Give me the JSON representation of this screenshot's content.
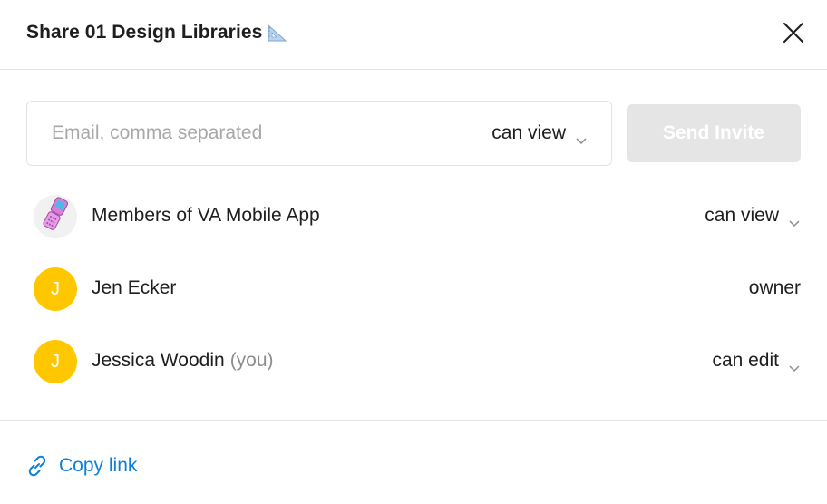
{
  "header": {
    "title": "Share 01 Design Libraries",
    "title_icon": "triangular-ruler-emoji",
    "close_icon": "close-icon"
  },
  "invite": {
    "placeholder": "Email, comma separated",
    "value": "",
    "permission": "can view",
    "send_label": "Send Invite",
    "send_enabled": false
  },
  "members": [
    {
      "name": "Members of VA Mobile App",
      "you_suffix": "",
      "avatar_type": "team",
      "avatar_icon": "flip-phone-icon",
      "role": "can view",
      "role_editable": true
    },
    {
      "name": "Jen Ecker",
      "you_suffix": "",
      "avatar_type": "user",
      "avatar_initial": "J",
      "role": "owner",
      "role_editable": false
    },
    {
      "name": "Jessica Woodin",
      "you_suffix": "(you)",
      "avatar_type": "user",
      "avatar_initial": "J",
      "role": "can edit",
      "role_editable": true
    }
  ],
  "footer": {
    "copy_link_label": "Copy link",
    "copy_link_icon": "link-icon"
  },
  "colors": {
    "accent": "#0d7fd8",
    "avatar_yellow": "#ffc700",
    "send_disabled_bg": "#e5e5e5",
    "border": "#e3e3e3",
    "muted_text": "#8c8c8c"
  }
}
